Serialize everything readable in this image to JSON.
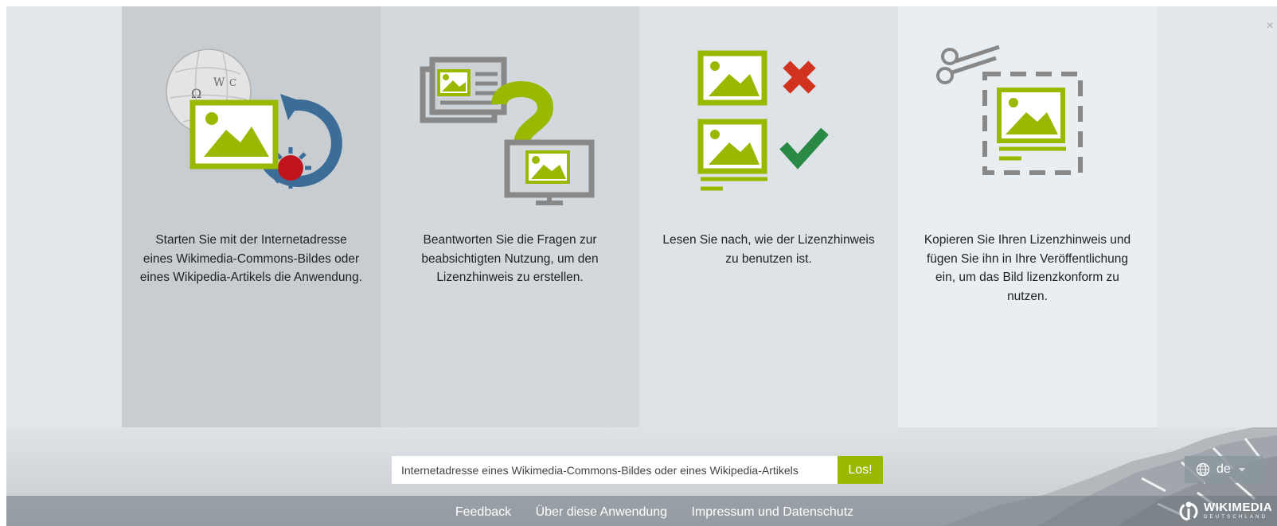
{
  "steps": [
    {
      "icon": "wikipedia-globe-commons-icon",
      "text": "Starten Sie mit der Internetadresse eines Wikimedia-Commons-Bildes oder eines Wikipedia-Artikels die Anwendung."
    },
    {
      "icon": "question-icon",
      "text": "Beantworten Sie die Fragen zur beabsichtigten Nutzung, um den Lizenzhinweis zu erstellen."
    },
    {
      "icon": "dos-and-donts-icon",
      "text": "Lesen Sie nach, wie der Lizenzhinweis zu benutzen ist."
    },
    {
      "icon": "scissors-copy-icon",
      "text": "Kopieren Sie Ihren Lizenzhinweis und fügen Sie ihn in Ihre Veröffentlichung ein, um das Bild lizenzkonform zu nutzen."
    }
  ],
  "close_label": "×",
  "search": {
    "placeholder": "Internetadresse eines Wikimedia-Commons-Bildes oder eines Wikipedia-Artikels",
    "button_label": "Los!"
  },
  "language": {
    "icon": "globe-icon",
    "selected": "de"
  },
  "footer": {
    "links": [
      "Feedback",
      "Über diese Anwendung",
      "Impressum und Datenschutz"
    ]
  },
  "logo": {
    "title": "WIKIMEDIA",
    "subtitle": "DEUTSCHLAND"
  },
  "colors": {
    "accent_green": "#99b800",
    "cross_red": "#d0331f",
    "check_green": "#2a8a45",
    "commons_blue": "#3b6d98"
  }
}
